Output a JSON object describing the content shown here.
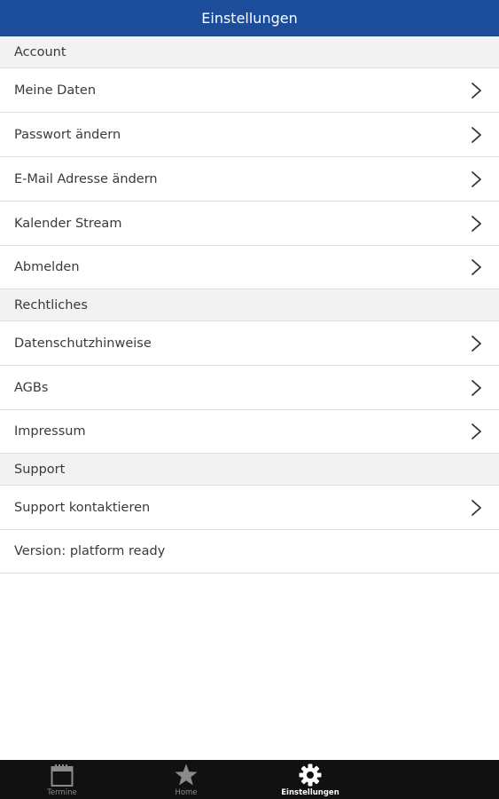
{
  "header": {
    "title": "Einstellungen"
  },
  "sections": {
    "account": {
      "title": "Account",
      "items": [
        {
          "label": "Meine Daten"
        },
        {
          "label": "Passwort ändern"
        },
        {
          "label": "E-Mail Adresse ändern"
        },
        {
          "label": "Kalender Stream"
        },
        {
          "label": "Abmelden"
        }
      ]
    },
    "legal": {
      "title": "Rechtliches",
      "items": [
        {
          "label": "Datenschutzhinweise"
        },
        {
          "label": "AGBs"
        },
        {
          "label": "Impressum"
        }
      ]
    },
    "support": {
      "title": "Support",
      "items": [
        {
          "label": "Support kontaktieren"
        }
      ],
      "version": "Version: platform ready"
    }
  },
  "tabbar": {
    "tabs": [
      {
        "label": "Termine",
        "icon": "calendar-icon"
      },
      {
        "label": "Home",
        "icon": "star-icon"
      },
      {
        "label": "Einstellungen",
        "icon": "gear-icon",
        "active": true
      }
    ]
  },
  "colors": {
    "header_bg": "#1b4d9b",
    "section_bg": "#f2f2f2",
    "tabbar_bg": "#111111",
    "tab_inactive": "#8a8a8a",
    "tab_active": "#ffffff"
  }
}
